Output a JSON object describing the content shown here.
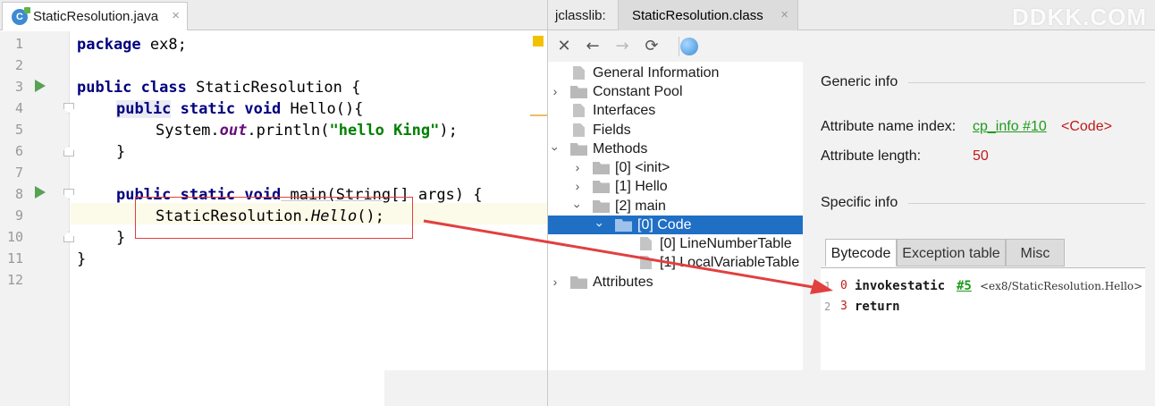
{
  "editor": {
    "tab_label": "StaticResolution.java",
    "tab_icon_letter": "C",
    "close_glyph": "×",
    "line_numbers": [
      "1",
      "2",
      "3",
      "4",
      "5",
      "6",
      "7",
      "8",
      "9",
      "10",
      "11",
      "12"
    ],
    "code": {
      "l1_kw": "package",
      "l1_rest": " ex8;",
      "l3_kw1": "public",
      "l3_kw2": "class",
      "l3_rest": " StaticResolution {",
      "l4_kw1": "public",
      "l4_kw2": "static",
      "l4_kw3": "void",
      "l4_rest": " Hello(){",
      "l5_pre": "System.",
      "l5_field": "out",
      "l5_mid": ".println(",
      "l5_str": "\"hello King\"",
      "l5_post": ");",
      "l6": "}",
      "l8_kw1": "public",
      "l8_kw2": "static",
      "l8_kw3": "void",
      "l8_rest1": " main(",
      "l8_type": "String",
      "l8_rest2": "[] args) {",
      "l9_pre": "StaticResolution.",
      "l9_call": "Hello",
      "l9_post": "();",
      "l10": "}",
      "l11": "}"
    }
  },
  "jclasslib": {
    "prefix": "jclasslib:",
    "tab_label": "StaticResolution.class",
    "close_glyph": "×",
    "watermark": "DDKK.COM",
    "toolbar": {
      "close": "✕",
      "back": "←",
      "forward": "→",
      "refresh": "⟳",
      "web_icon": "globe-icon"
    },
    "tree": [
      {
        "label": "General Information"
      },
      {
        "label": "Constant Pool"
      },
      {
        "label": "Interfaces"
      },
      {
        "label": "Fields"
      },
      {
        "label": "Methods"
      },
      {
        "label": "[0] <init>"
      },
      {
        "label": "[1] Hello"
      },
      {
        "label": "[2] main"
      },
      {
        "label": "[0] Code"
      },
      {
        "label": "[0] LineNumberTable"
      },
      {
        "label": "[1] LocalVariableTable"
      },
      {
        "label": "Attributes"
      }
    ],
    "generic_info": {
      "title": "Generic info",
      "name_index_label": "Attribute name index:",
      "name_index_link": "cp_info #10",
      "name_index_value": "<Code>",
      "length_label": "Attribute length:",
      "length_value": "50"
    },
    "specific_info": {
      "title": "Specific info",
      "tabs": [
        "Bytecode",
        "Exception table",
        "Misc"
      ],
      "active_tab": "Bytecode"
    },
    "bytecode": [
      {
        "line": "1",
        "offset": "0",
        "op": "invokestatic",
        "ref": "#5",
        "comment": "<ex8/StaticResolution.Hello>"
      },
      {
        "line": "2",
        "offset": "3",
        "op": "return"
      }
    ]
  },
  "colors": {
    "keyword": "#000080",
    "string": "#008000",
    "field": "#660e7a",
    "selection": "#1f6fc5",
    "link": "#1e9a1e",
    "accent_red": "#e23f3f"
  }
}
